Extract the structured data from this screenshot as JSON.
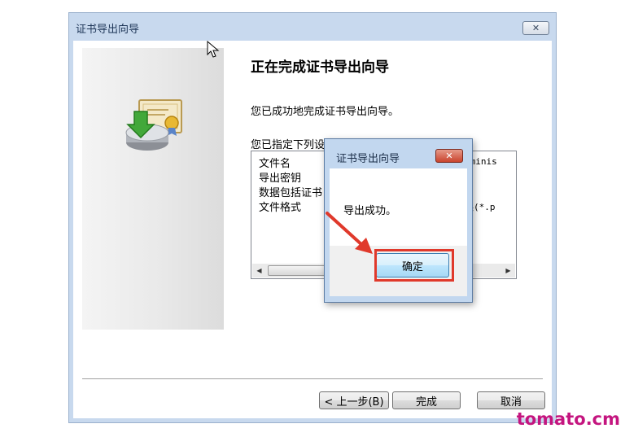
{
  "wizard": {
    "title": "证书导出向导",
    "close_label": "✕",
    "heading": "正在完成证书导出向导",
    "description": "您已成功地完成证书导出向导。",
    "settings_label": "您已指定下列设置",
    "settings": [
      {
        "name": "文件名",
        "value": "dminis"
      },
      {
        "name": "导出密钥",
        "value": ""
      },
      {
        "name": "数据包括证书",
        "value": ""
      },
      {
        "name": "文件格式",
        "value": "换(*.p"
      }
    ],
    "buttons": {
      "back": "< 上一步(B)",
      "finish": "完成",
      "cancel": "取消"
    }
  },
  "messagebox": {
    "title": "证书导出向导",
    "close_label": "✕",
    "message": "导出成功。",
    "ok_label": "确定"
  },
  "watermark": "tomato.cm",
  "colors": {
    "annotation": "#e0392b",
    "watermark": "#c4157f"
  }
}
